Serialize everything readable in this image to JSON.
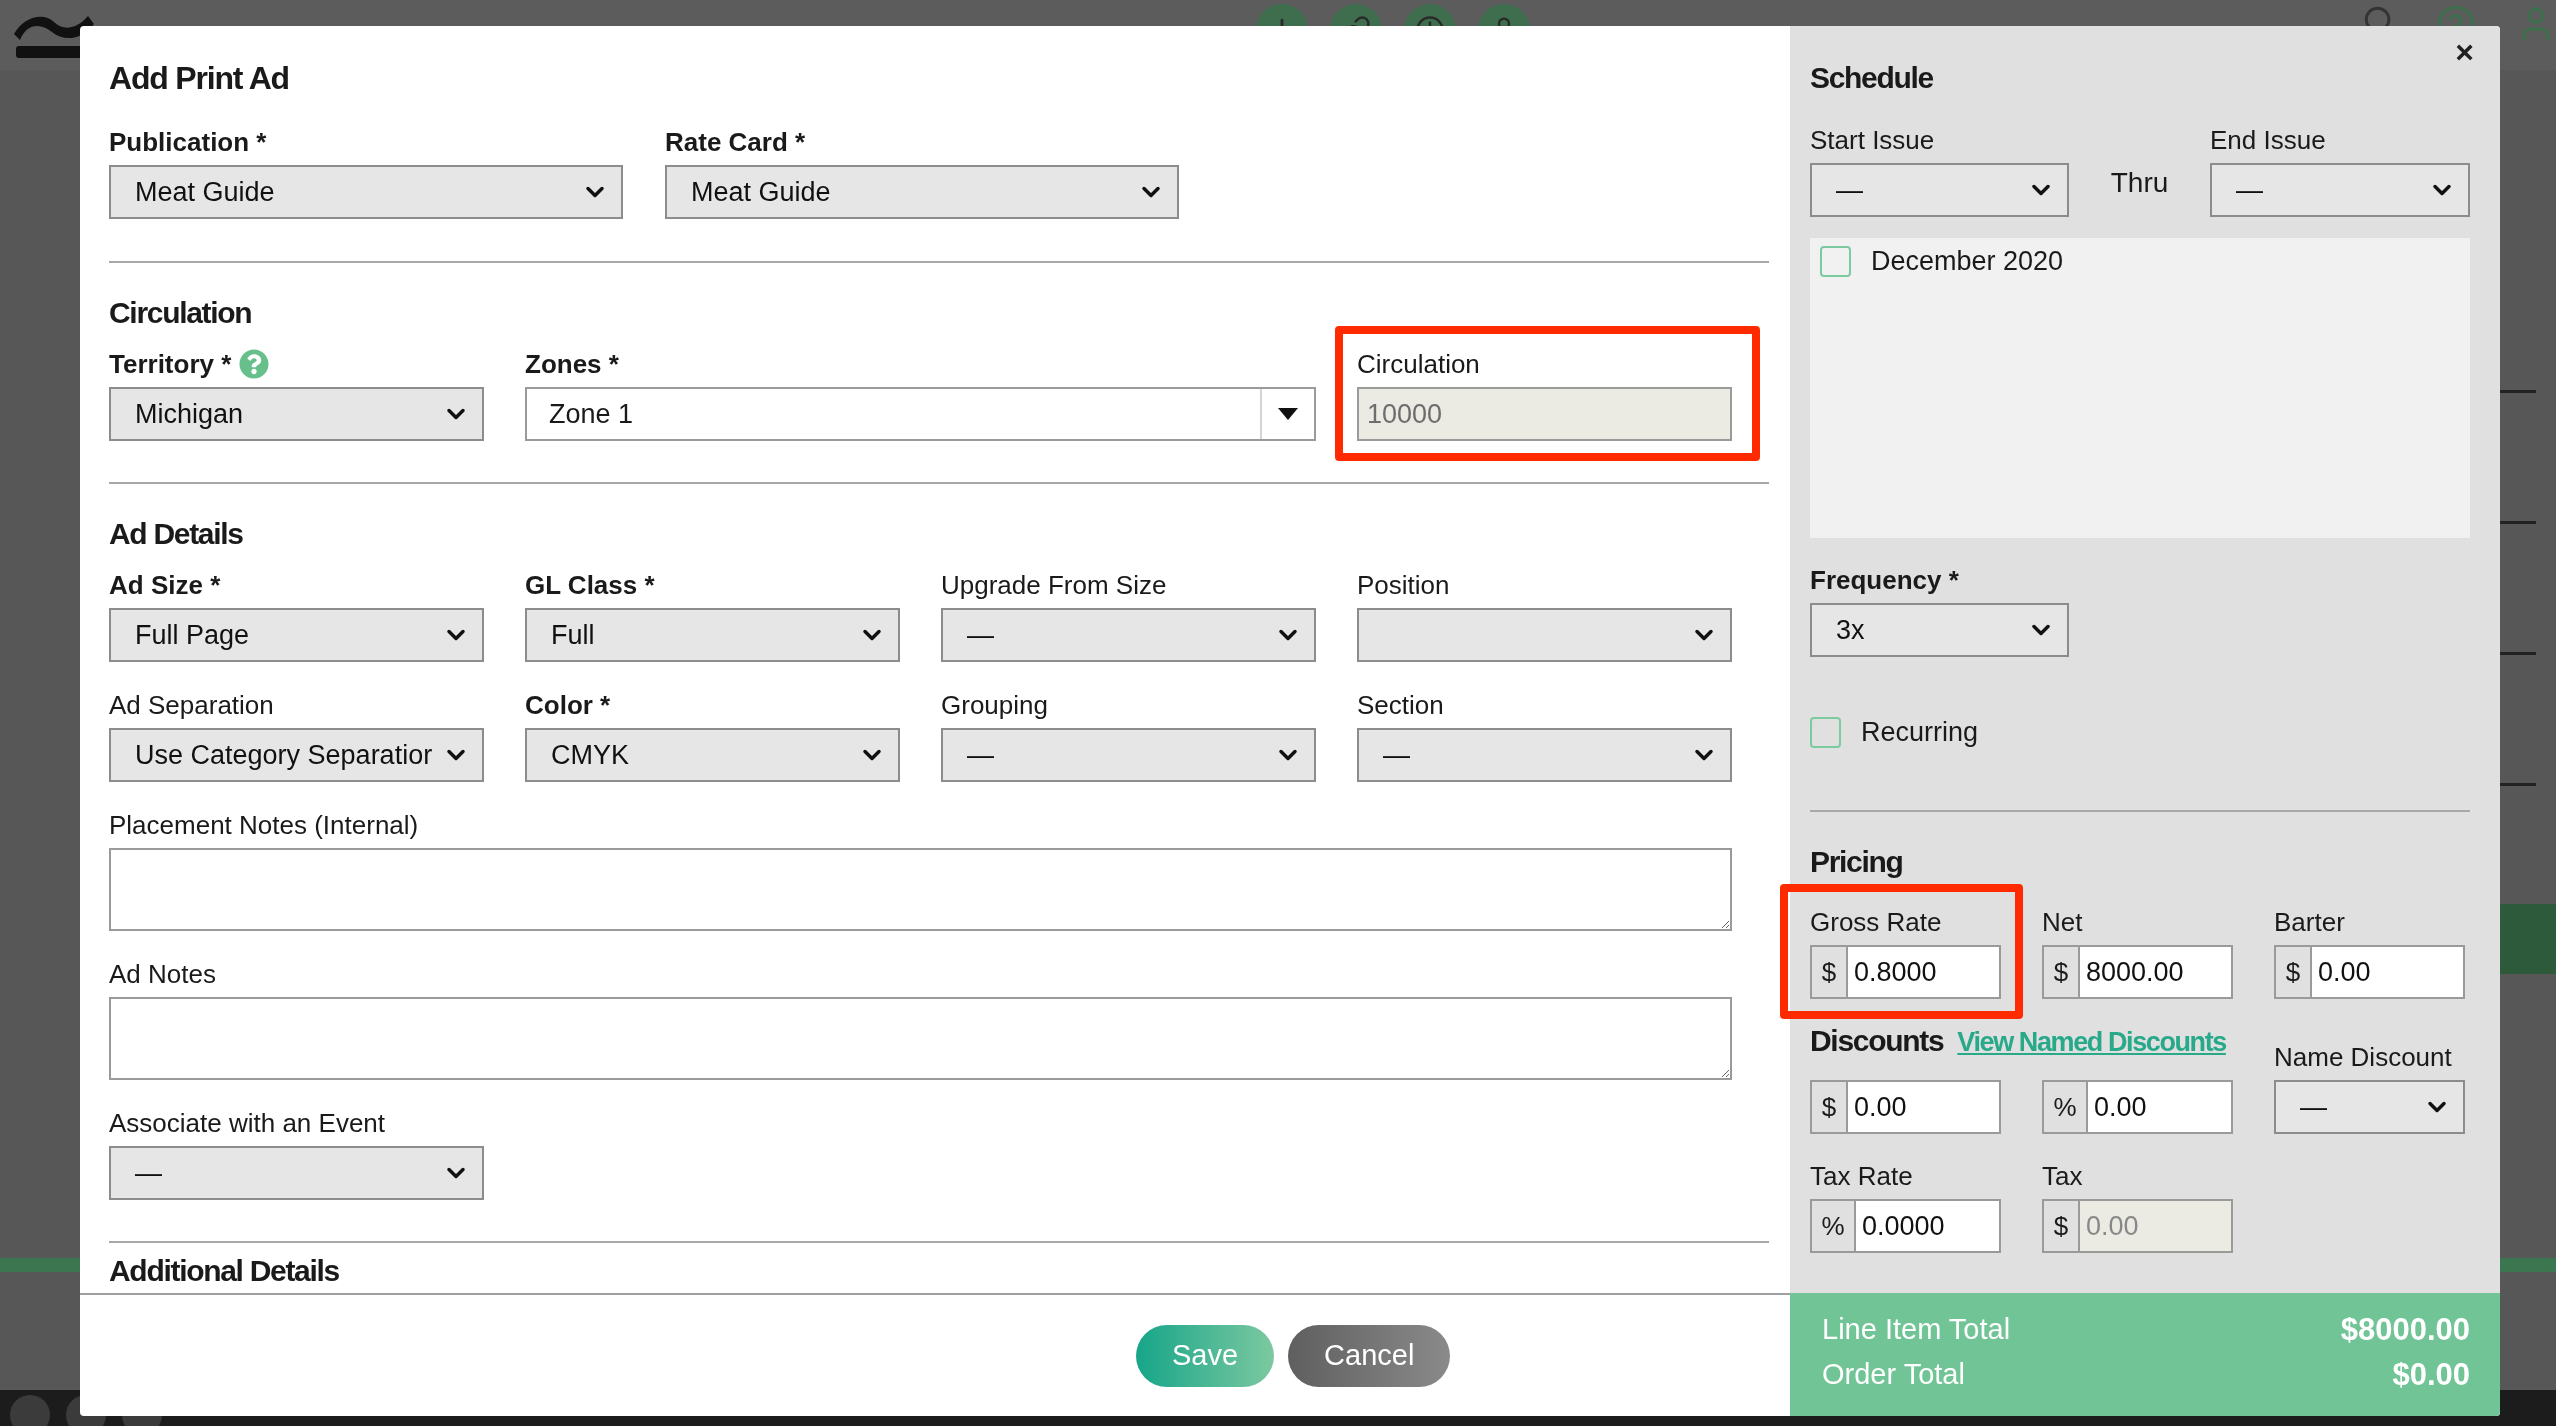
{
  "modal": {
    "title": "Add Print Ad",
    "close": "×",
    "top_fields": [
      {
        "label": "Publication *",
        "required": true,
        "kind": "select",
        "value": "Meat Guide"
      },
      {
        "label": "Rate Card *",
        "required": true,
        "kind": "select",
        "value": "Meat Guide"
      }
    ],
    "sections": [
      {
        "heading": "Circulation",
        "rows": [
          [
            {
              "label": "Territory *",
              "required": true,
              "kind": "select",
              "value": "Michigan",
              "help": true
            },
            {
              "label": "Zones *",
              "required": true,
              "kind": "combo",
              "value": "Zone 1"
            },
            {
              "label": "Circulation",
              "required": false,
              "kind": "readonly",
              "value": "10000",
              "highlighted": true
            }
          ]
        ]
      },
      {
        "heading": "Ad Details",
        "rows": [
          [
            {
              "label": "Ad Size *",
              "required": true,
              "kind": "select",
              "value": "Full Page"
            },
            {
              "label": "GL Class *",
              "required": true,
              "kind": "select",
              "value": "Full"
            },
            {
              "label": "Upgrade From Size",
              "required": false,
              "kind": "select",
              "value": "—"
            },
            {
              "label": "Position",
              "required": false,
              "kind": "select"
            }
          ],
          [
            {
              "label": "Ad Separation",
              "required": false,
              "kind": "select",
              "value": "Use Category Separatior"
            },
            {
              "label": "Color *",
              "required": true,
              "kind": "select",
              "value": "CMYK"
            },
            {
              "label": "Grouping",
              "required": false,
              "kind": "select",
              "value": "—"
            },
            {
              "label": "Section",
              "required": false,
              "kind": "select",
              "value": "—"
            }
          ],
          [
            {
              "label": "Placement Notes (Internal)",
              "required": false,
              "kind": "textarea"
            }
          ],
          [
            {
              "label": "Ad Notes",
              "required": false,
              "kind": "textarea"
            }
          ],
          [
            {
              "label": "Associate with an Event",
              "required": false,
              "kind": "select",
              "value": "—"
            }
          ]
        ]
      }
    ],
    "next_heading": "Additional Details",
    "buttons": [
      {
        "label": "Save",
        "kind": "primary"
      },
      {
        "label": "Cancel",
        "kind": "secondary"
      }
    ]
  },
  "schedule": {
    "heading": "Schedule",
    "start": {
      "label": "Start Issue",
      "value": "—"
    },
    "thru": "Thru",
    "end": {
      "label": "End Issue",
      "value": "—"
    },
    "issues": [
      {
        "label": "December 2020",
        "checked": false
      }
    ],
    "frequency": {
      "label": "Frequency *",
      "required": true,
      "value": "3x"
    },
    "recurring": {
      "label": "Recurring",
      "checked": false
    }
  },
  "pricing": {
    "heading": "Pricing",
    "rates": [
      {
        "label": "Gross Rate",
        "prefix": "$",
        "value": "0.8000",
        "highlighted": true
      },
      {
        "label": "Net",
        "prefix": "$",
        "value": "8000.00"
      },
      {
        "label": "Barter",
        "prefix": "$",
        "value": "0.00"
      }
    ],
    "discounts": {
      "heading": "Discounts",
      "link": "View Named Discounts",
      "amount": {
        "prefix": "$",
        "value": "0.00"
      },
      "percent": {
        "prefix": "%",
        "value": "0.00"
      },
      "named": {
        "label": "Name Discount",
        "value": "—"
      }
    },
    "tax": [
      {
        "label": "Tax Rate",
        "prefix": "%",
        "value": "0.0000",
        "readonly": false
      },
      {
        "label": "Tax",
        "prefix": "$",
        "value": "0.00",
        "readonly": true
      }
    ]
  },
  "totals": [
    {
      "label": "Line Item Total",
      "value": "$8000.00"
    },
    {
      "label": "Order Total",
      "value": "$0.00"
    }
  ]
}
